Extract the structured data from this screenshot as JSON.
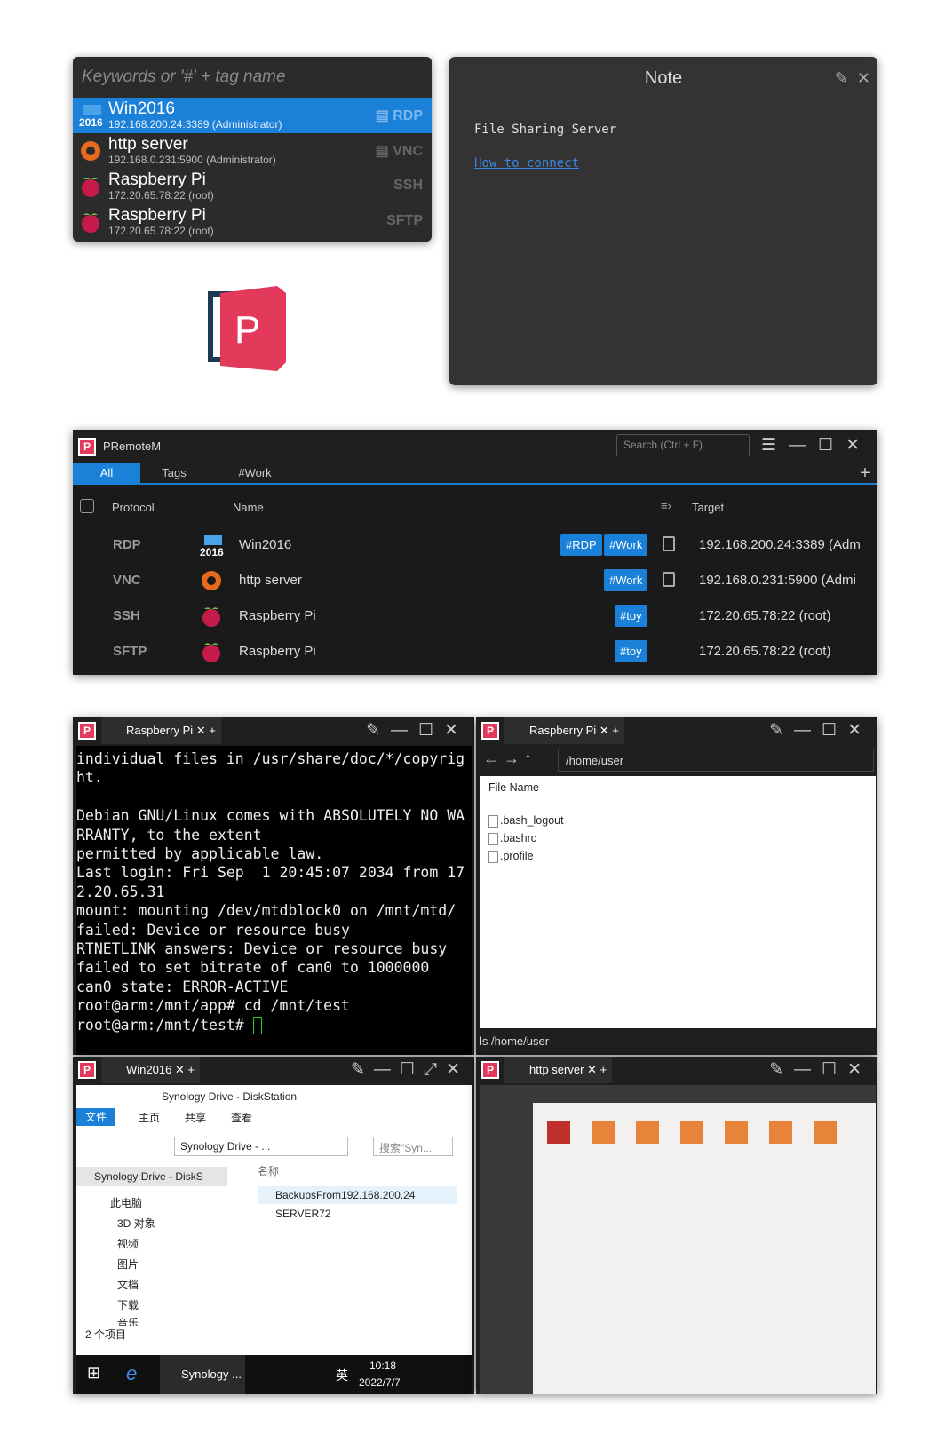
{
  "launcher": {
    "placeholder": "Keywords or '#' + tag name",
    "items": [
      {
        "title": "Win2016",
        "sub": "192.168.200.24:3389 (Administrator)",
        "proto": "RDP",
        "selected": true
      },
      {
        "title": "http server",
        "sub": "192.168.0.231:5900 (Administrator)",
        "proto": "VNC"
      },
      {
        "title": "Raspberry Pi",
        "sub": "172.20.65.78:22 (root)",
        "proto": "SSH"
      },
      {
        "title": "Raspberry Pi",
        "sub": "172.20.65.78:22 (root)",
        "proto": "SFTP"
      }
    ]
  },
  "note": {
    "title": "Note",
    "text": "File Sharing Server",
    "link": "How to connect"
  },
  "logo": {
    "letter": "P"
  },
  "main": {
    "title": "PRemoteM",
    "search": "Search (Ctrl + F)",
    "tabs": [
      "All",
      "Tags",
      "#Work"
    ],
    "columns": {
      "protocol": "Protocol",
      "name": "Name",
      "target": "Target"
    },
    "rows": [
      {
        "protocol": "RDP",
        "name": "Win2016",
        "tags": [
          "#RDP",
          "#Work"
        ],
        "target": "192.168.200.24:3389 (Adm"
      },
      {
        "protocol": "VNC",
        "name": "http server",
        "tags": [
          "#Work"
        ],
        "target": "192.168.0.231:5900 (Admi"
      },
      {
        "protocol": "SSH",
        "name": "Raspberry Pi",
        "tags": [
          "#toy"
        ],
        "target": "172.20.65.78:22 (root)"
      },
      {
        "protocol": "SFTP",
        "name": "Raspberry Pi",
        "tags": [
          "#toy"
        ],
        "target": "172.20.65.78:22 (root)"
      }
    ]
  },
  "term": {
    "tab": "Raspberry Pi",
    "lines": "individual files in /usr/share/doc/*/copyrig\nht.\n\nDebian GNU/Linux comes with ABSOLUTELY NO WA\nRRANTY, to the extent\npermitted by applicable law.\nLast login: Fri Sep  1 20:45:07 2034 from 17\n2.20.65.31\nmount: mounting /dev/mtdblock0 on /mnt/mtd/\nfailed: Device or resource busy\nRTNETLINK answers: Device or resource busy\nfailed to set bitrate of can0 to 1000000\ncan0 state: ERROR-ACTIVE\nroot@arm:/mnt/app# cd /mnt/test\nroot@arm:/mnt/test# "
  },
  "sftp": {
    "tab": "Raspberry Pi",
    "path": "/home/user",
    "header": "File Name",
    "files": [
      ".bash_logout",
      ".bashrc",
      ".profile"
    ],
    "status": "ls /home/user"
  },
  "rdp": {
    "tab": "Win2016",
    "explorer_title": "Synology Drive - DiskStation",
    "ribbon": [
      "文件",
      "主页",
      "共享",
      "查看"
    ],
    "address": "Synology Drive - ...",
    "search": "搜索\"Syn...",
    "nav": [
      "Synology Drive - DiskS",
      "此电脑",
      "3D 对象",
      "视频",
      "图片",
      "文档",
      "下载",
      "音乐"
    ],
    "col": "名称",
    "files": [
      "BackupsFrom192.168.200.24",
      "SERVER72"
    ],
    "status": "2 个项目",
    "taskbar_app": "Synology ...",
    "ime": "英",
    "time": "10:18",
    "date": "2022/7/7"
  },
  "vnc": {
    "tab": "http server"
  },
  "colors": {
    "accent": "#1a80d8",
    "logo": "#e33a5b",
    "bg": "#1f1f1f"
  }
}
